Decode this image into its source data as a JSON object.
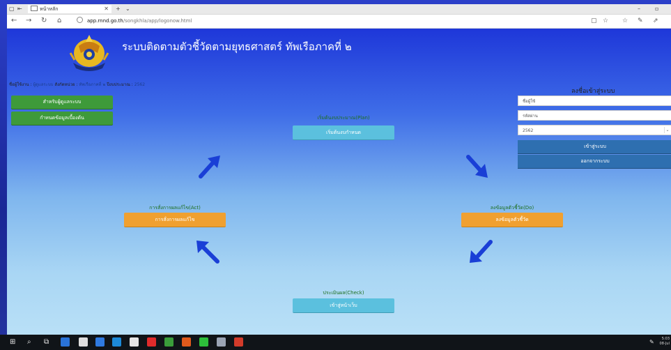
{
  "browser": {
    "tab_title": "หน้าหลัก",
    "address_host": "app.rnnd.go.th",
    "address_path": "/songkhla/app/logonow.html"
  },
  "page": {
    "site_title": "ระบบติดตามตัวชี้วัดตามยุทธศาสตร์ ทัพเรือภาคที่ ๒",
    "info": {
      "user_label": "ชื่อผู้ใช้งาน :",
      "user_value": "ผู้ดูแลระบบ",
      "unit_label": "สังกัดหน่วย :",
      "unit_value": "ทัพเรือภาคที่ ๒",
      "year_label": "ปีงบประมาณ :",
      "year_value": "2562"
    },
    "left_menu": [
      "สำหรับผู้ดูแลระบบ",
      "กำหนดข้อมูลเบื้องต้น"
    ],
    "cycle": {
      "plan": {
        "label": "เริ่มต้นงบประมาณ(Plan)",
        "button": "เริ่มต้นงบกำหนด"
      },
      "do": {
        "label": "ลงข้อมูลตัวชี้วัด(Do)",
        "button": "ลงข้อมูลตัวชี้วัด"
      },
      "check": {
        "label": "ประเมินผล(Check)",
        "button": "เข้าสู่หน้าเว็บ"
      },
      "act": {
        "label": "การสั่งการผลแก้ไข(Act)",
        "button": "การสั่งการผลแก้ไข"
      }
    },
    "login": {
      "title": "ลงชื่อเข้าสู่ระบบ",
      "username_placeholder": "ชื่อผู้ใช้",
      "password_placeholder": "รหัสผ่าน",
      "year_selected": "2562",
      "login_button": "เข้าสู่ระบบ",
      "logout_button": "ออกจากระบบ"
    }
  },
  "taskbar": {
    "time": "5:03",
    "date": "08-Jul"
  },
  "colors": {
    "green_button": "#3e9a3a",
    "teal_button": "#5bc0de",
    "orange_button": "#f0a030",
    "blue_button": "#2e6fb0",
    "arrow_blue": "#1a3fd6",
    "label_green": "#1d6e1d"
  }
}
